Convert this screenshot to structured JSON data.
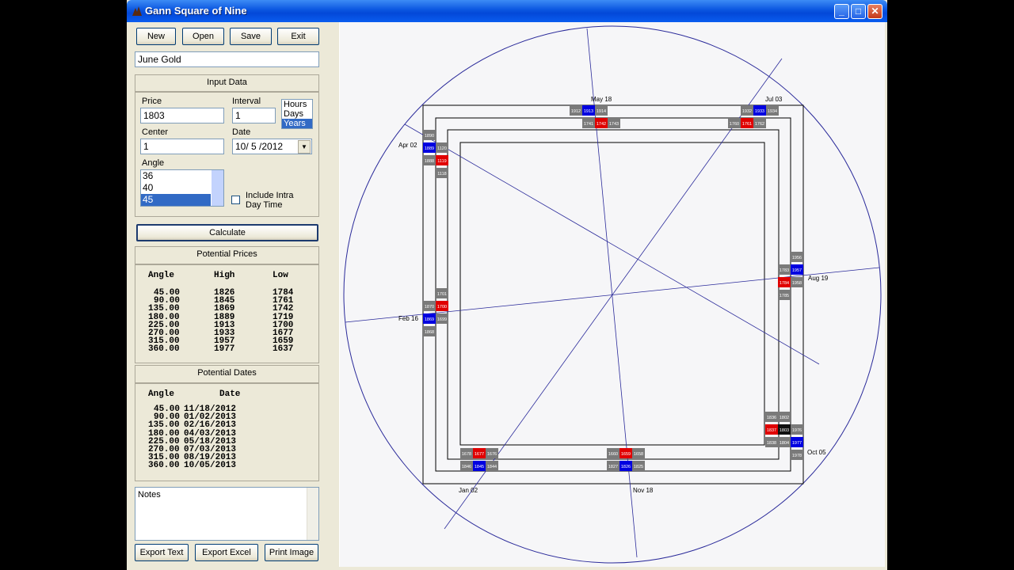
{
  "window": {
    "title": "Gann Square of Nine"
  },
  "toolbar": {
    "new": "New",
    "open": "Open",
    "save": "Save",
    "exit": "Exit"
  },
  "name_field": "June Gold",
  "input": {
    "header": "Input Data",
    "price_label": "Price",
    "price": "1803",
    "interval_label": "Interval",
    "interval": "1",
    "center_label": "Center",
    "center": "1",
    "date_label": "Date",
    "date": "10/ 5 /2012",
    "angle_label": "Angle",
    "angles": [
      "36",
      "40",
      "45"
    ],
    "units": [
      "Hours",
      "Days",
      "Years"
    ],
    "intraday_label": "Include Intra Day Time"
  },
  "calculate": "Calculate",
  "prices": {
    "header": "Potential Prices",
    "cols": [
      "Angle",
      "High",
      "Low"
    ],
    "rows": [
      [
        "45.00",
        "1826",
        "1784"
      ],
      [
        "90.00",
        "1845",
        "1761"
      ],
      [
        "135.00",
        "1869",
        "1742"
      ],
      [
        "180.00",
        "1889",
        "1719"
      ],
      [
        "225.00",
        "1913",
        "1700"
      ],
      [
        "270.00",
        "1933",
        "1677"
      ],
      [
        "315.00",
        "1957",
        "1659"
      ],
      [
        "360.00",
        "1977",
        "1637"
      ]
    ]
  },
  "dates": {
    "header": "Potential Dates",
    "cols": [
      "Angle",
      "Date"
    ],
    "rows": [
      [
        "45.00",
        "11/18/2012"
      ],
      [
        "90.00",
        "01/02/2013"
      ],
      [
        "135.00",
        "02/16/2013"
      ],
      [
        "180.00",
        "04/03/2013"
      ],
      [
        "225.00",
        "05/18/2013"
      ],
      [
        "270.00",
        "07/03/2013"
      ],
      [
        "315.00",
        "08/19/2013"
      ],
      [
        "360.00",
        "10/05/2013"
      ]
    ]
  },
  "notes": "Notes",
  "footer": {
    "export_text": "Export Text",
    "export_excel": "Export Excel",
    "print_image": "Print Image"
  },
  "chart_data": {
    "type": "gann-square-of-nine",
    "date_labels": [
      "May 18",
      "Jul 03",
      "Aug 19",
      "Oct 05",
      "Nov 18",
      "Jan 02",
      "Feb 16",
      "Apr 02"
    ],
    "cells": {
      "top": [
        "1912",
        "1913",
        "1914",
        "1932",
        "1933",
        "1934",
        "1741",
        "1742",
        "1743",
        "1760",
        "1761",
        "1762"
      ],
      "left": [
        "1890",
        "1889",
        "1120",
        "1888",
        "1119",
        "1118",
        "1701",
        "1870",
        "1700",
        "1869",
        "1699",
        "1868"
      ],
      "right": [
        "1956",
        "1783",
        "1957",
        "1784",
        "1958",
        "1785",
        "1836",
        "1802",
        "1837",
        "1803",
        "1976",
        "1838",
        "1804",
        "1977",
        "1978"
      ],
      "bottom": [
        "1678",
        "1677",
        "1676",
        "1846",
        "1845",
        "1844",
        "1660",
        "1659",
        "1658",
        "1827",
        "1826",
        "1825"
      ]
    },
    "colors": {
      "blue": "#0000e0",
      "red": "#e00000",
      "gray": "#7a7a7a",
      "line": "#2a2a9a"
    }
  }
}
